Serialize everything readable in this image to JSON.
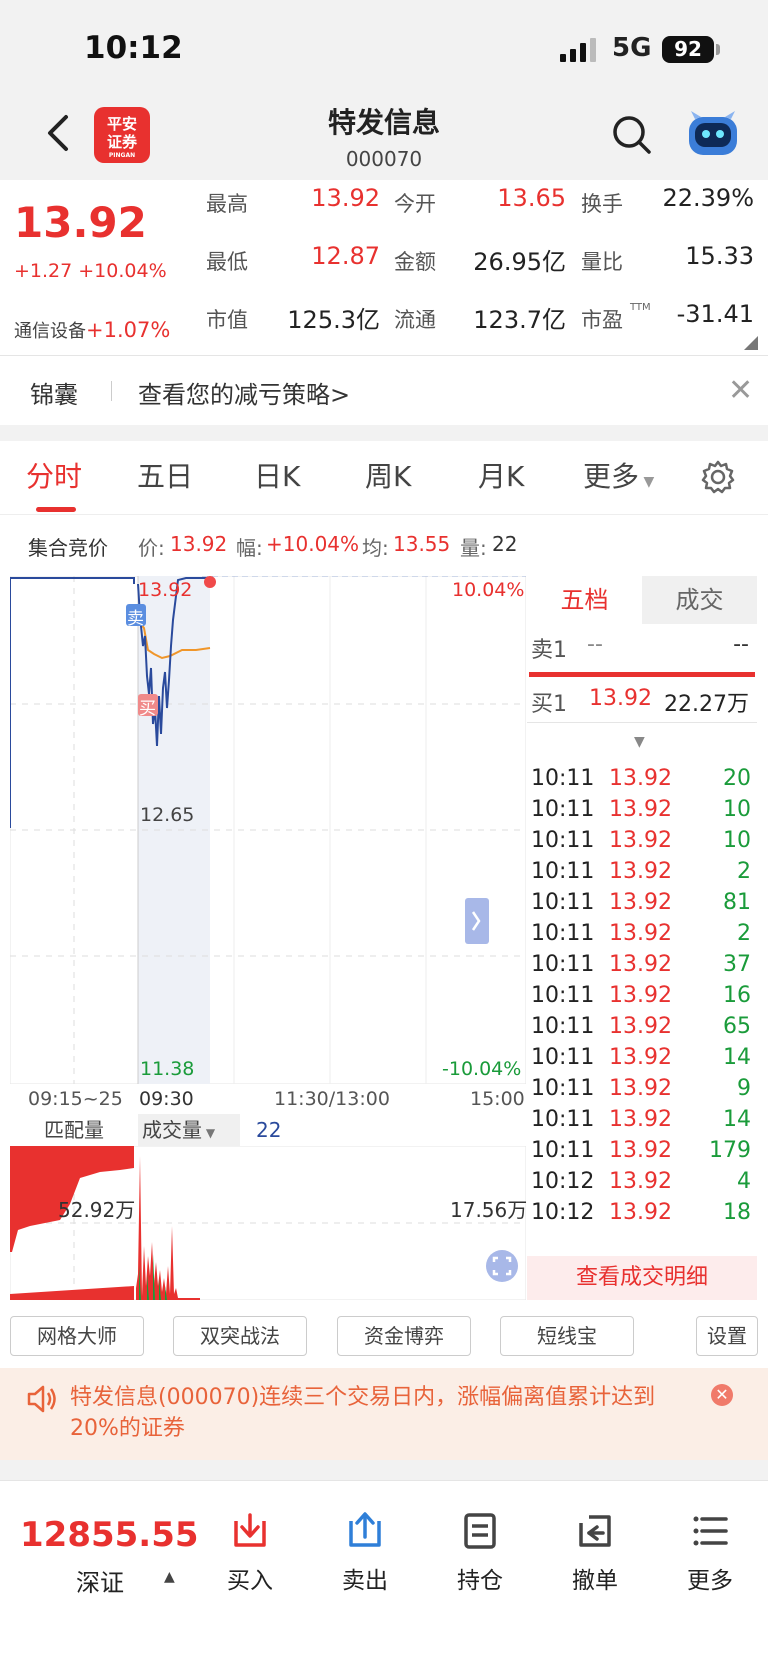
{
  "status_bar": {
    "time": "10:12",
    "network": "5G",
    "battery": "92"
  },
  "header": {
    "logo_text_1": "平安",
    "logo_text_2": "证券",
    "logo_sub": "PINGAN",
    "title": "特发信息",
    "code": "000070"
  },
  "quote": {
    "price": "13.92",
    "change": "+1.27  +10.04%",
    "sector_name": "通信设备",
    "sector_change": "+1.07%",
    "high_label": "最高",
    "high": "13.92",
    "open_label": "今开",
    "open": "13.65",
    "turnover_label": "换手",
    "turnover": "22.39%",
    "low_label": "最低",
    "low": "12.87",
    "amount_label": "金额",
    "amount": "26.95亿",
    "vol_ratio_label": "量比",
    "vol_ratio": "15.33",
    "mcap_label": "市值",
    "mcap": "125.3亿",
    "float_label": "流通",
    "float": "123.7亿",
    "pe_label": "市盈",
    "pe_sup": "TTM",
    "pe": "-31.41"
  },
  "banner": {
    "tag": "锦囊",
    "text": "查看您的减亏策略>"
  },
  "tabs": [
    "分时",
    "五日",
    "日K",
    "周K",
    "月K",
    "更多"
  ],
  "info_line": {
    "label": "集合竞价",
    "price_label": "价:",
    "price": "13.92",
    "range_label": "幅:",
    "range": "+10.04%",
    "avg_label": "均:",
    "avg": "13.55",
    "vol_label": "量:",
    "vol": "22"
  },
  "chart": {
    "y_top": "13.92",
    "y_mid": "12.65",
    "y_bottom": "11.38",
    "pct_top": "10.04%",
    "pct_bottom": "-10.04%",
    "sell_marker": "卖",
    "buy_marker": "买",
    "time_labels": [
      "09:15~25",
      "09:30",
      "11:30/13:00",
      "15:00"
    ]
  },
  "volume": {
    "match_label": "匹配量",
    "vol_dropdown": "成交量",
    "vol_value": "22",
    "left_value": "52.92万",
    "right_value": "17.56万"
  },
  "order_book": {
    "tab1": "五档",
    "tab2": "成交",
    "sell1_label": "卖1",
    "sell1_price": "--",
    "sell1_vol": "--",
    "buy1_label": "买1",
    "buy1_price": "13.92",
    "buy1_vol": "22.27万",
    "ticks": [
      {
        "t": "10:11",
        "p": "13.92",
        "v": "20"
      },
      {
        "t": "10:11",
        "p": "13.92",
        "v": "10"
      },
      {
        "t": "10:11",
        "p": "13.92",
        "v": "10"
      },
      {
        "t": "10:11",
        "p": "13.92",
        "v": "2"
      },
      {
        "t": "10:11",
        "p": "13.92",
        "v": "81"
      },
      {
        "t": "10:11",
        "p": "13.92",
        "v": "2"
      },
      {
        "t": "10:11",
        "p": "13.92",
        "v": "37"
      },
      {
        "t": "10:11",
        "p": "13.92",
        "v": "16"
      },
      {
        "t": "10:11",
        "p": "13.92",
        "v": "65"
      },
      {
        "t": "10:11",
        "p": "13.92",
        "v": "14"
      },
      {
        "t": "10:11",
        "p": "13.92",
        "v": "9"
      },
      {
        "t": "10:11",
        "p": "13.92",
        "v": "14"
      },
      {
        "t": "10:11",
        "p": "13.92",
        "v": "179"
      },
      {
        "t": "10:12",
        "p": "13.92",
        "v": "4"
      },
      {
        "t": "10:12",
        "p": "13.92",
        "v": "18"
      }
    ],
    "detail_button": "查看成交明细"
  },
  "tools": [
    "网格大师",
    "双突战法",
    "资金博弈",
    "短线宝",
    "设置"
  ],
  "notice": {
    "text": "特发信息(000070)连续三个交易日内，涨幅偏离值累计达到20%的证券"
  },
  "bottom_nav": {
    "index_value": "12855.55",
    "index_name": "深证",
    "items": [
      "买入",
      "卖出",
      "持仓",
      "撤单",
      "更多"
    ]
  },
  "colors": {
    "up": "#e8312f",
    "down": "#1a9b3a",
    "price_line": "#2a4a9c",
    "avg_line": "#f0962a"
  }
}
